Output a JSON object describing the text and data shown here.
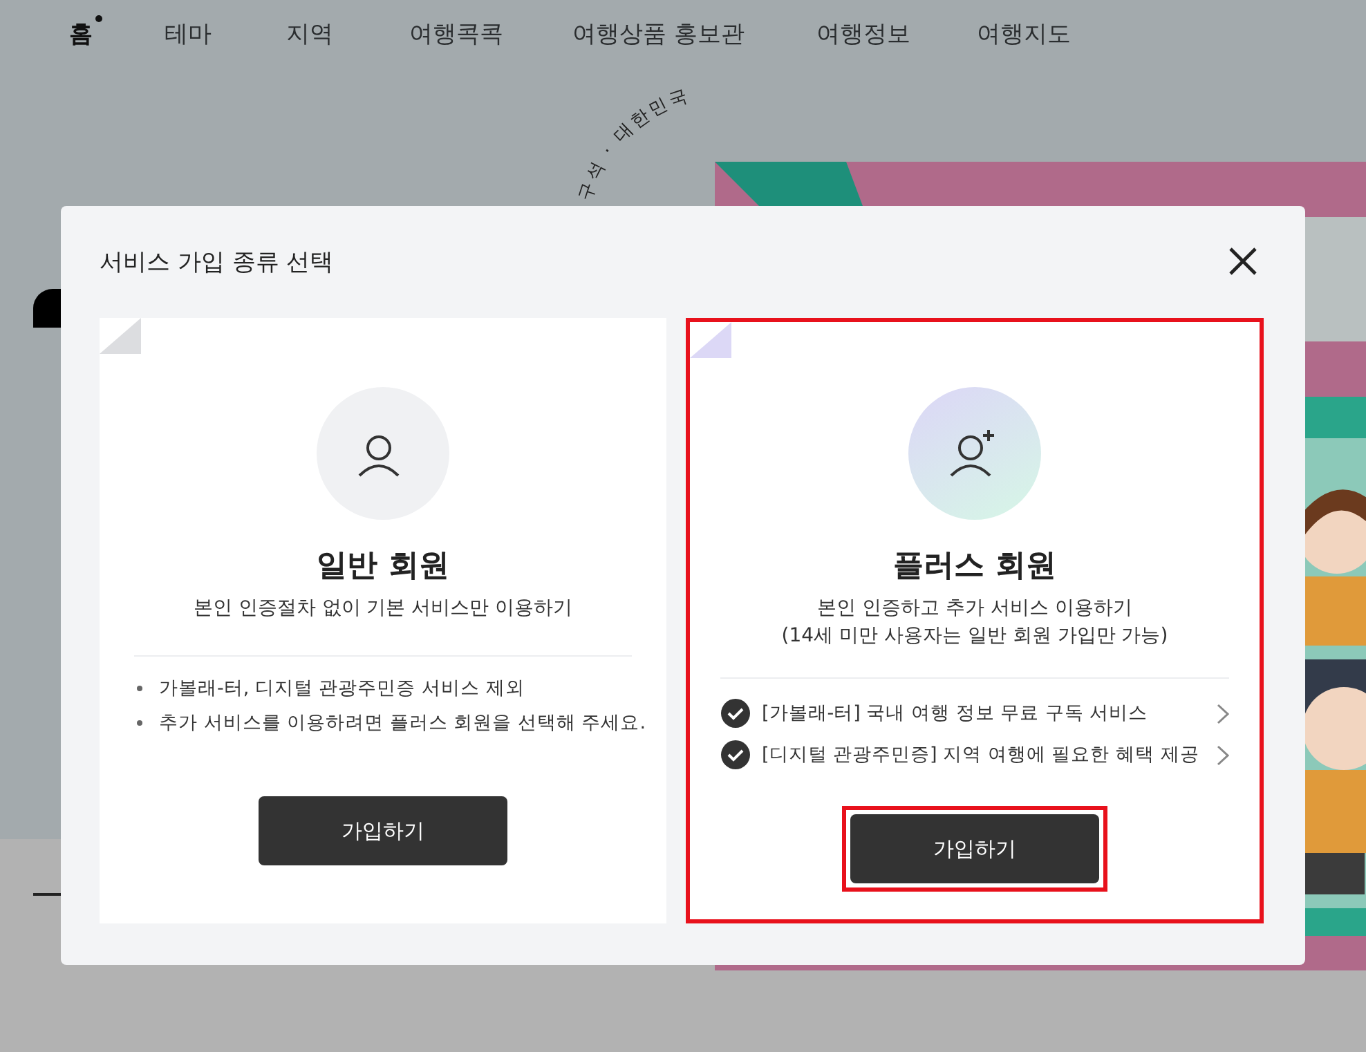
{
  "nav": [
    {
      "label": "홈",
      "selected": true
    },
    {
      "label": "테마",
      "selected": false
    },
    {
      "label": "지역",
      "selected": false
    },
    {
      "label": "여행콕콕",
      "selected": false
    },
    {
      "label": "여행상품 홍보관",
      "selected": false
    },
    {
      "label": "여행정보",
      "selected": false
    },
    {
      "label": "여행지도",
      "selected": false
    }
  ],
  "hero": {
    "badge_text": "구석 · 대한민국"
  },
  "modal": {
    "title": "서비스 가입 종류 선택",
    "cards": [
      {
        "kind": "basic",
        "highlighted": false,
        "title": "일반 회원",
        "description": [
          "본인 인증절차 없이 기본 서비스만 이용하기"
        ],
        "features": [
          {
            "kind": "bullet",
            "text": "가볼래-터, 디지털 관광주민증 서비스 제외"
          },
          {
            "kind": "bullet",
            "text": "추가 서비스를 이용하려면 플러스 회원을 선택해 주세요."
          }
        ],
        "button": {
          "label": "가입하기",
          "highlighted": false
        }
      },
      {
        "kind": "plus",
        "highlighted": true,
        "title": "플러스 회원",
        "description": [
          "본인 인증하고 추가 서비스 이용하기",
          "(14세 미만 사용자는 일반 회원 가입만 가능)"
        ],
        "features": [
          {
            "kind": "check",
            "text": "[가볼래-터] 국내 여행 정보 무료 구독 서비스"
          },
          {
            "kind": "check",
            "text": "[디지털 관광주민증] 지역 여행에 필요한 혜택 제공"
          }
        ],
        "button": {
          "label": "가입하기",
          "highlighted": true
        }
      }
    ]
  }
}
